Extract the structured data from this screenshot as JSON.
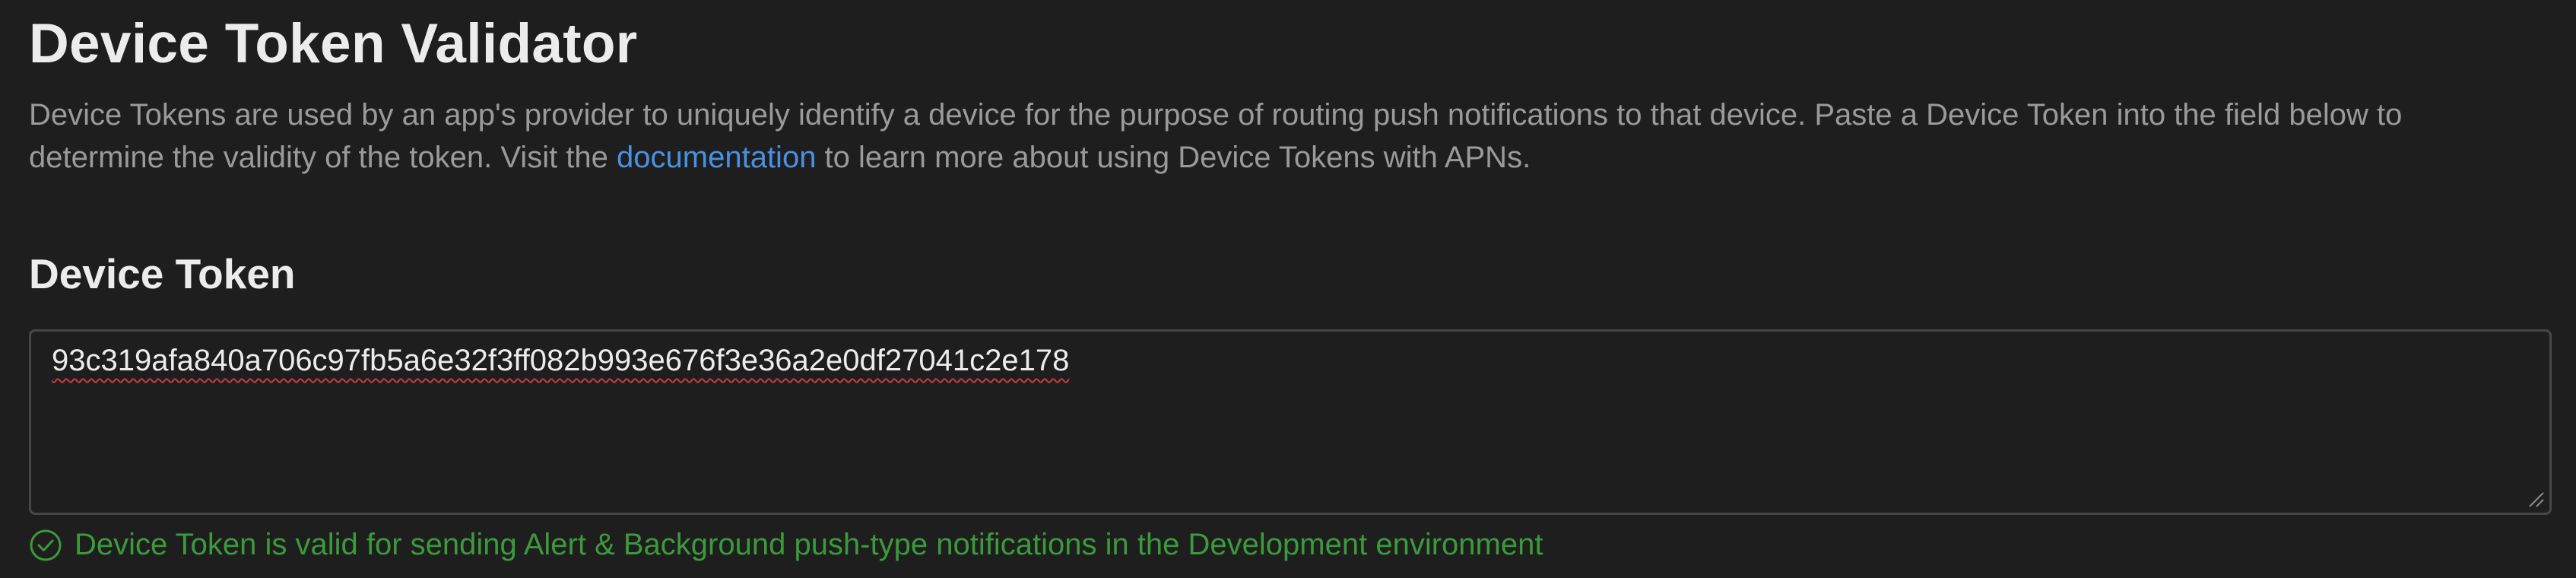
{
  "header": {
    "title": "Device Token Validator",
    "description_before_link": "Device Tokens are used by an app's provider to uniquely identify a device for the purpose of routing push notifications to that device. Paste a Device Token into the field below to determine the validity of the token. Visit the ",
    "link_label": "documentation",
    "description_after_link": " to learn more about using Device Tokens with APNs."
  },
  "token_section": {
    "label": "Device Token",
    "value": "93c319afa840a706c97fb5a6e32f3ff082b993e676f3e36a2e0df27041c2e178"
  },
  "status": {
    "icon": "check-circle-icon",
    "message": "Device Token is valid for sending Alert & Background push-type notifications in the Development environment",
    "color": "#3b9a3b"
  },
  "colors": {
    "background": "#1e1e1e",
    "link": "#4a90e2",
    "valid": "#3b9a3b"
  }
}
